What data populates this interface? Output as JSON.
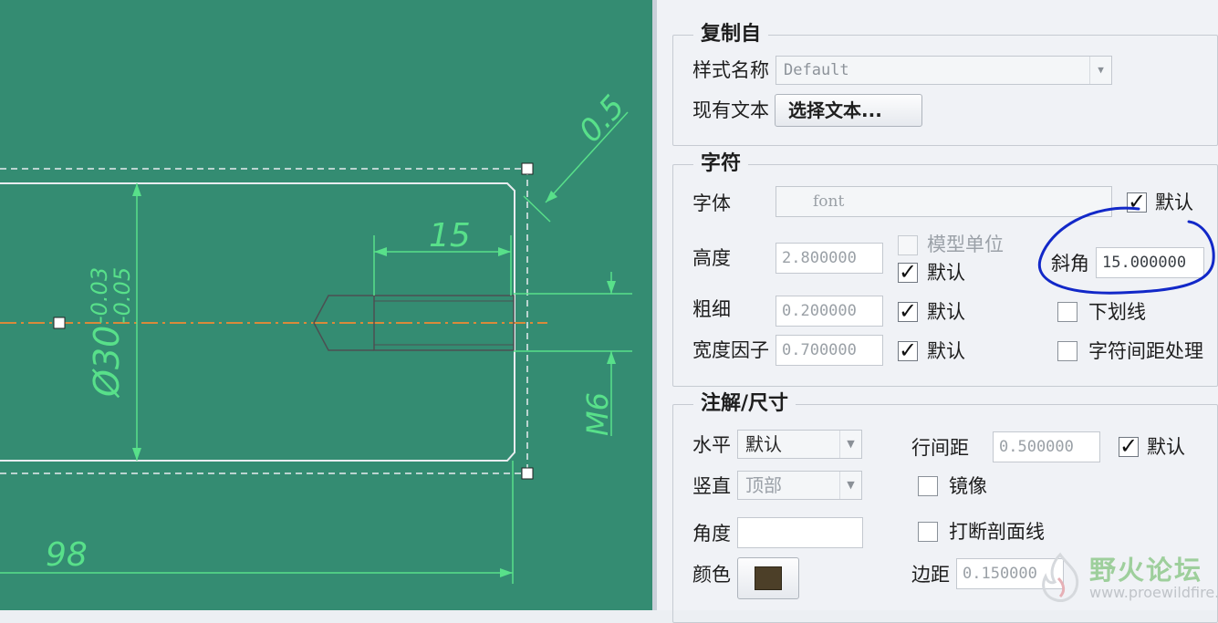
{
  "drawing": {
    "dim_chamfer": "0.5",
    "dim_length": "15",
    "dim_diameter": "Ø30",
    "dim_tol_upper": "-0.03",
    "dim_tol_lower": "-0.05",
    "dim_thread": "M6",
    "dim_total": "98",
    "colors": {
      "background": "#348c72",
      "dimension": "#58e08a",
      "centerline": "#d98a3a",
      "outline": "#e8ecef"
    }
  },
  "panel": {
    "copy_from": {
      "title": "复制自",
      "style_name_label": "样式名称",
      "style_name_value": "Default",
      "existing_text_label": "现有文本",
      "select_text_button": "选择文本..."
    },
    "character": {
      "title": "字符",
      "font_label": "字体",
      "font_value": "font",
      "font_default_label": "默认",
      "height_label": "高度",
      "height_value": "2.800000",
      "model_units_label": "模型单位",
      "height_default_label": "默认",
      "thickness_label": "粗细",
      "thickness_value": "0.200000",
      "thickness_default_label": "默认",
      "width_factor_label": "宽度因子",
      "width_factor_value": "0.700000",
      "width_default_label": "默认",
      "slant_label": "斜角",
      "slant_value": "15.000000",
      "underline_label": "下划线",
      "kerning_label": "字符间距处理"
    },
    "note_dim": {
      "title": "注解/尺寸",
      "horizontal_label": "水平",
      "horizontal_value": "默认",
      "vertical_label": "竖直",
      "vertical_value": "顶部",
      "angle_label": "角度",
      "angle_value": "",
      "color_label": "颜色",
      "line_spacing_label": "行间距",
      "line_spacing_value": "0.500000",
      "line_spacing_default_label": "默认",
      "mirror_label": "镜像",
      "break_hatch_label": "打断剖面线",
      "margin_label": "边距",
      "margin_value": "0.150000"
    }
  },
  "watermark": {
    "title": "野火论坛",
    "url": "www.proewildfire.cn"
  }
}
